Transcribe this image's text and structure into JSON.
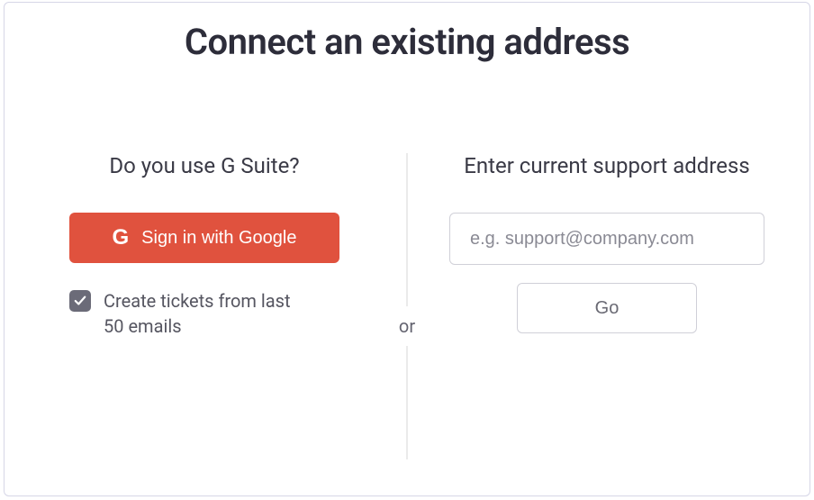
{
  "title": "Connect an existing address",
  "or_label": "or",
  "left": {
    "heading": "Do you use G Suite?",
    "google_button_label": "Sign in with Google",
    "checkbox_label": "Create tickets from last 50 emails",
    "checkbox_checked": true
  },
  "right": {
    "heading": "Enter current support address",
    "email_placeholder": "e.g. support@company.com",
    "email_value": "",
    "go_button_label": "Go"
  }
}
